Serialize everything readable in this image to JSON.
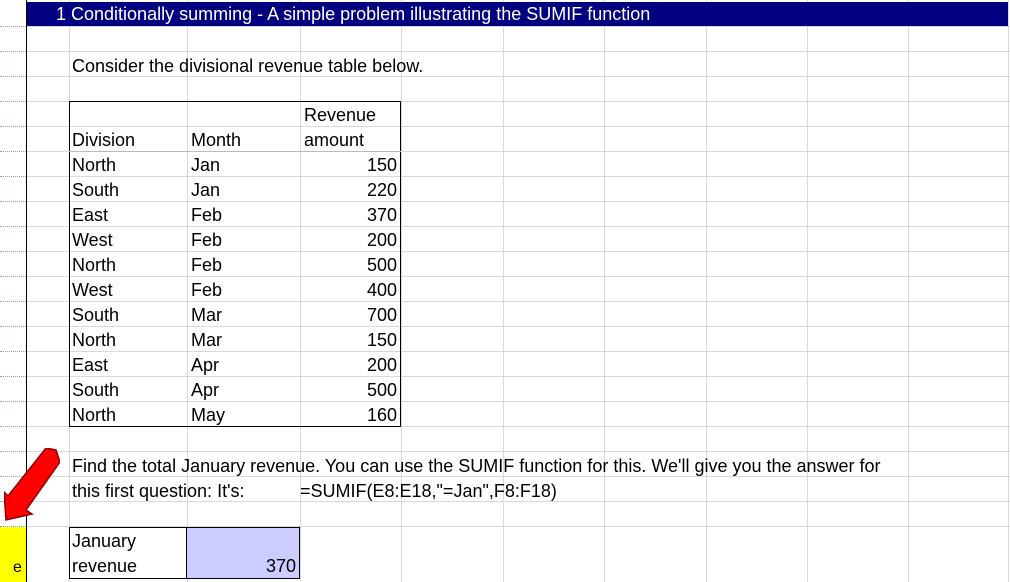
{
  "title": "1 Conditionally summing - A simple problem illustrating the SUMIF function",
  "intro": "Consider the divisional revenue table below.",
  "table": {
    "headers": {
      "division": "Division",
      "month": "Month",
      "revenue_line1": "Revenue",
      "revenue_line2": "amount"
    },
    "rows": [
      {
        "division": "North",
        "month": "Jan",
        "revenue": "150"
      },
      {
        "division": "South",
        "month": "Jan",
        "revenue": "220"
      },
      {
        "division": "East",
        "month": "Feb",
        "revenue": "370"
      },
      {
        "division": "West",
        "month": "Feb",
        "revenue": "200"
      },
      {
        "division": "North",
        "month": "Feb",
        "revenue": "500"
      },
      {
        "division": "West",
        "month": "Feb",
        "revenue": "400"
      },
      {
        "division": "South",
        "month": "Mar",
        "revenue": "700"
      },
      {
        "division": "North",
        "month": "Mar",
        "revenue": "150"
      },
      {
        "division": "East",
        "month": "Apr",
        "revenue": "200"
      },
      {
        "division": "South",
        "month": "Apr",
        "revenue": "500"
      },
      {
        "division": "North",
        "month": "May",
        "revenue": "160"
      }
    ]
  },
  "question": {
    "line1": "Find the total January revenue.  You can use the SUMIF function for this.  We'll give you the answer for",
    "line2_prefix": "this first question:  It's:",
    "formula": "=SUMIF(E8:E18,\"=Jan\",F8:F18)"
  },
  "answer": {
    "label_line1": "January",
    "label_line2": "revenue",
    "value": "370"
  },
  "row_header_letter": "e",
  "colors": {
    "title_bg": "#000080",
    "answer_bg": "#ccccff",
    "highlight": "#ffff00",
    "arrow": "#ff0000"
  }
}
